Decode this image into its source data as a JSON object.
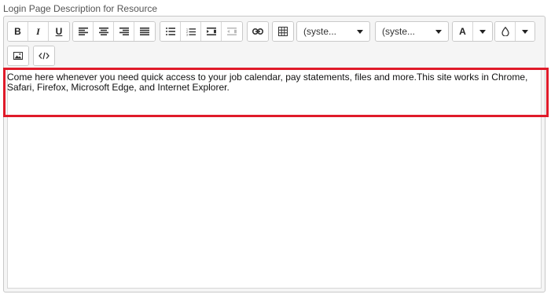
{
  "field": {
    "label": "Login Page Description for Resource"
  },
  "toolbar": {
    "bold": "B",
    "italic": "I",
    "underline": "U",
    "font_family_value": "(syste...",
    "font_size_value": "(syste...",
    "font_color_label": "A",
    "icons": [
      "bold-icon",
      "italic-icon",
      "underline-icon",
      "align-left-icon",
      "align-center-icon",
      "align-right-icon",
      "align-justify-icon",
      "bulleted-list-icon",
      "numbered-list-icon",
      "indent-icon",
      "outdent-icon",
      "link-icon",
      "table-icon",
      "chevron-down-icon",
      "font-color-icon",
      "fill-color-icon",
      "image-icon",
      "code-view-icon"
    ]
  },
  "editor": {
    "content": "Come here whenever you need quick access to your job calendar, pay statements, files and more.This site works in Chrome, Safari, Firefox, Microsoft Edge, and Internet Explorer."
  },
  "colors": {
    "highlight": "#e01b2a",
    "border": "#c8c8c8",
    "toolbar_bg": "#f5f5f5"
  }
}
